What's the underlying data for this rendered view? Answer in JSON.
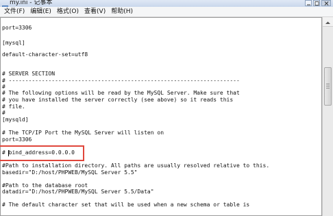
{
  "window": {
    "title": "my.ini - 记事本"
  },
  "menu": [
    "文件(F)",
    "编辑(E)",
    "格式(O)",
    "查看(V)",
    "帮助(H)"
  ],
  "editor": {
    "lines": [
      "port=3306",
      "",
      "[mysql]",
      "",
      "default-character-set=utf8",
      "",
      "",
      "# SERVER SECTION",
      "# ----------------------------------------------------------------------",
      "#",
      "# The following options will be read by the MySQL Server. Make sure that",
      "# you have installed the server correctly (see above) so it reads this",
      "# file.",
      "#",
      "[mysqld]",
      "",
      "# The TCP/IP Port the MySQL Server will listen on",
      "port=3306",
      "",
      "# bind_address=0.0.0.0",
      "",
      "#Path to installation directory. All paths are usually resolved relative to this.",
      "basedir=\"D:/host/PHPWEB/MySQL Server 5.5\"",
      "",
      "#Path to the database root",
      "datadir=\"D:/host/PHPWEB/MySQL Server 5.5/Data\"",
      "",
      "# The default character set that will be used when a new schema or table is"
    ]
  }
}
